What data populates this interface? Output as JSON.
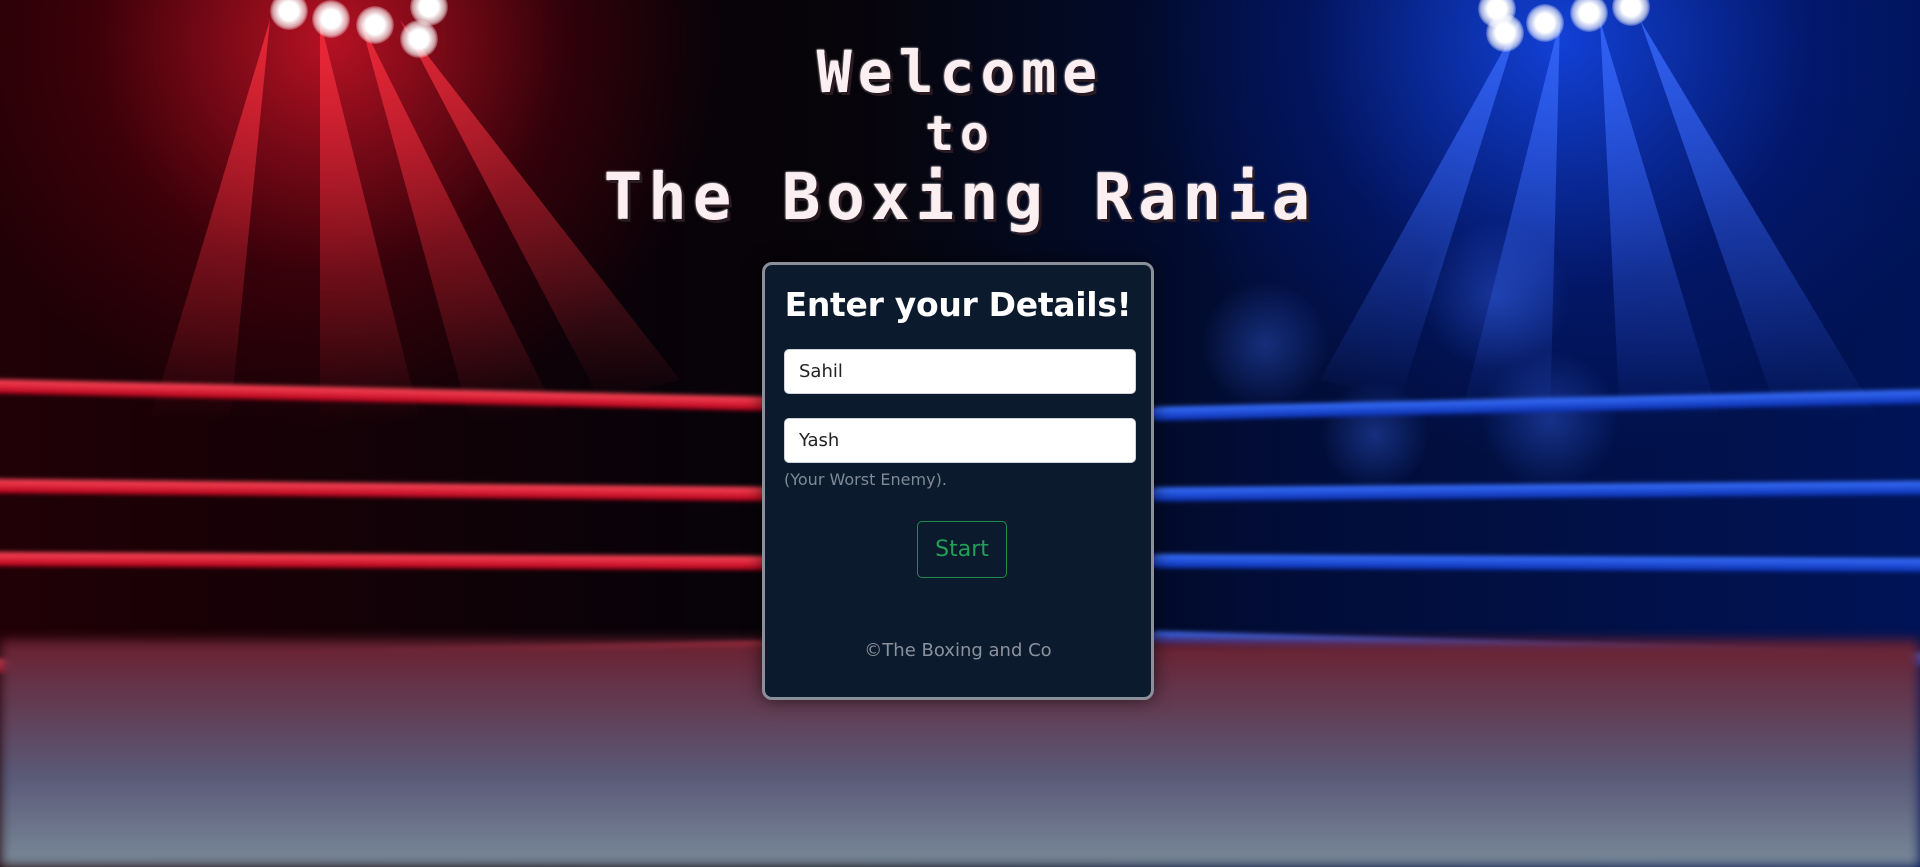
{
  "title": {
    "line1": "Welcome",
    "line2": "to",
    "line3": "The Boxing Rania"
  },
  "form": {
    "heading": "Enter your Details!",
    "player1_value": "Sahil",
    "player2_value": "Yash",
    "player2_helper": "(Your Worst Enemy).",
    "start_label": "Start"
  },
  "footer": {
    "copyright": "©The Boxing and Co"
  },
  "colors": {
    "card_background": "#0c1a2d",
    "start_button_accent": "#22a058",
    "corner_left": "#d0142a",
    "corner_right": "#1446e6"
  },
  "icons": {
    "background": "boxing-ring-arena-image"
  }
}
